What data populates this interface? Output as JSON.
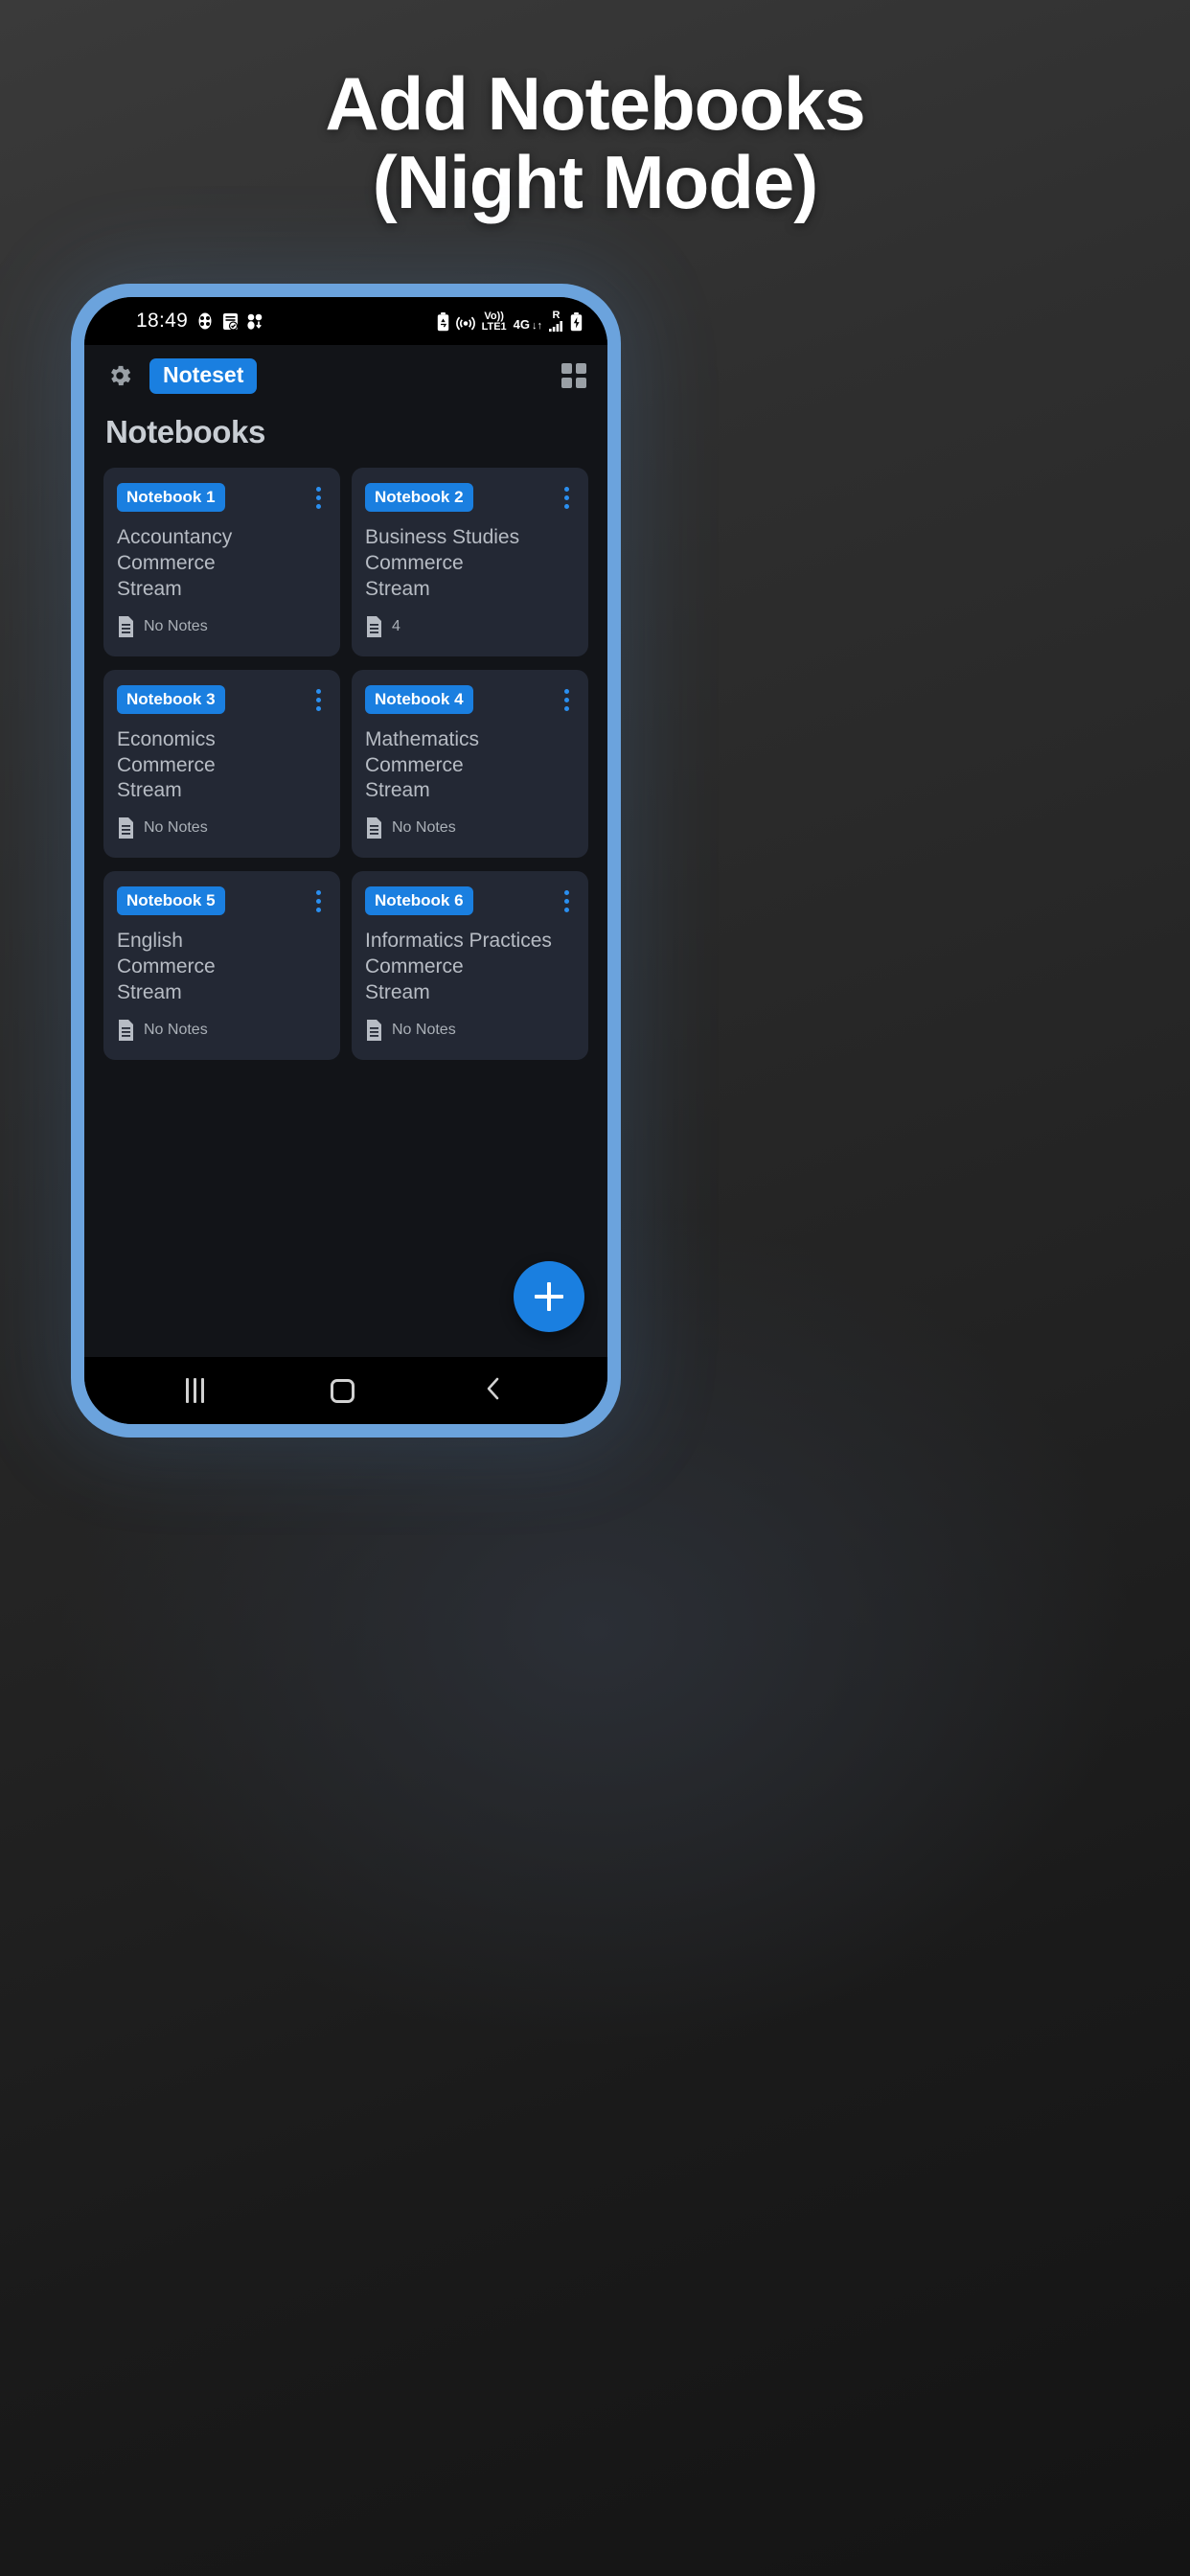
{
  "promo": {
    "title_line1": "Add Notebooks",
    "title_line2": "(Night Mode)"
  },
  "status_bar": {
    "time": "18:49",
    "left_icons": [
      "mask-icon",
      "note-check-icon",
      "people-download-icon"
    ],
    "right": {
      "battery_saver": "battery-recycle-icon",
      "hotspot": "hotspot-icon",
      "volte_line1": "Vo))",
      "volte_line2": "LTE1",
      "network": "4G",
      "data_arrows": "↓↑",
      "roaming": "R",
      "signal": "signal-bars-icon",
      "battery": "battery-charging-icon"
    }
  },
  "app_bar": {
    "settings_icon": "gear-icon",
    "app_name": "Noteset",
    "view_toggle_icon": "grid-view-icon"
  },
  "main": {
    "section_title": "Notebooks",
    "notebooks": [
      {
        "chip": "Notebook 1",
        "subject": "Accountancy",
        "stream_line1": "Commerce",
        "stream_line2": "Stream",
        "note_count": "No Notes"
      },
      {
        "chip": "Notebook 2",
        "subject": "Business Studies",
        "stream_line1": "Commerce",
        "stream_line2": "Stream",
        "note_count": "4"
      },
      {
        "chip": "Notebook 3",
        "subject": "Economics",
        "stream_line1": "Commerce",
        "stream_line2": "Stream",
        "note_count": "No Notes"
      },
      {
        "chip": "Notebook 4",
        "subject": "Mathematics",
        "stream_line1": "Commerce",
        "stream_line2": "Stream",
        "note_count": "No Notes"
      },
      {
        "chip": "Notebook 5",
        "subject": "English",
        "stream_line1": "Commerce",
        "stream_line2": "Stream",
        "note_count": "No Notes"
      },
      {
        "chip": "Notebook 6",
        "subject": "Informatics Practices",
        "stream_line1": "Commerce",
        "stream_line2": "Stream",
        "note_count": "No Notes"
      }
    ],
    "fab_icon": "plus-icon"
  },
  "nav_bar": {
    "recents": "recents-icon",
    "home": "home-icon",
    "back": "back-icon"
  },
  "colors": {
    "accent_blue": "#1a7fe0",
    "card_bg": "#232834",
    "screen_bg": "#121418",
    "frame_blue": "#6ba3dd",
    "text_muted": "#b7bcc4"
  }
}
